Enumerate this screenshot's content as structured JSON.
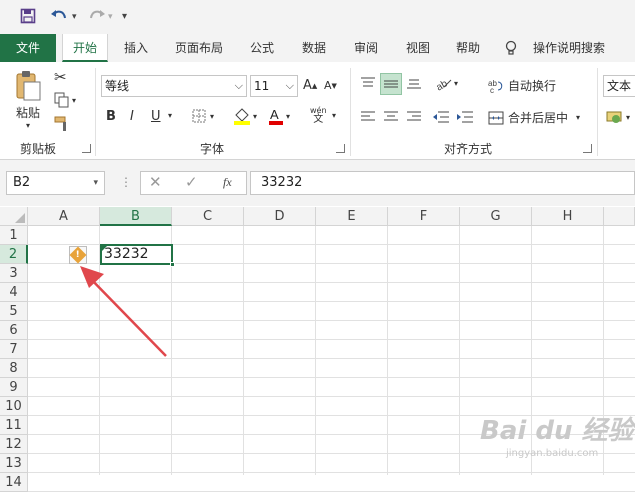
{
  "qat": {
    "save_icon": "save-icon",
    "undo_icon": "undo-icon",
    "redo_icon": "redo-icon",
    "customize_icon": "chevron-down-icon"
  },
  "tabs": {
    "file": "文件",
    "home": "开始",
    "insert": "插入",
    "page_layout": "页面布局",
    "formulas": "公式",
    "data": "数据",
    "review": "审阅",
    "view": "视图",
    "help": "帮助",
    "tell_me": "操作说明搜索"
  },
  "ribbon": {
    "clipboard": {
      "paste": "粘贴",
      "label": "剪贴板"
    },
    "font": {
      "font_name": "等线",
      "font_size": "11",
      "bold": "B",
      "italic": "I",
      "underline": "U",
      "phonetic": "wén",
      "label": "字体"
    },
    "alignment": {
      "wrap_text": "自动换行",
      "merge_center": "合并后居中",
      "label": "对齐方式"
    },
    "number": {
      "format": "文本"
    }
  },
  "formula_bar": {
    "name_box": "B2",
    "fx": "fx",
    "value": "33232"
  },
  "grid": {
    "columns": [
      "A",
      "B",
      "C",
      "D",
      "E",
      "F",
      "G",
      "H"
    ],
    "rows": [
      "1",
      "2",
      "3",
      "4",
      "5",
      "6",
      "7",
      "8",
      "9",
      "10",
      "11",
      "12",
      "13",
      "14"
    ],
    "active_cell_value": "33232",
    "warning_icon": "warning-icon"
  },
  "colors": {
    "accent": "#217346",
    "warning": "#e8a33a",
    "arrow": "#e0474c"
  },
  "watermark": {
    "brand": "Bai du 经验",
    "url": "jingyan.baidu.com"
  }
}
